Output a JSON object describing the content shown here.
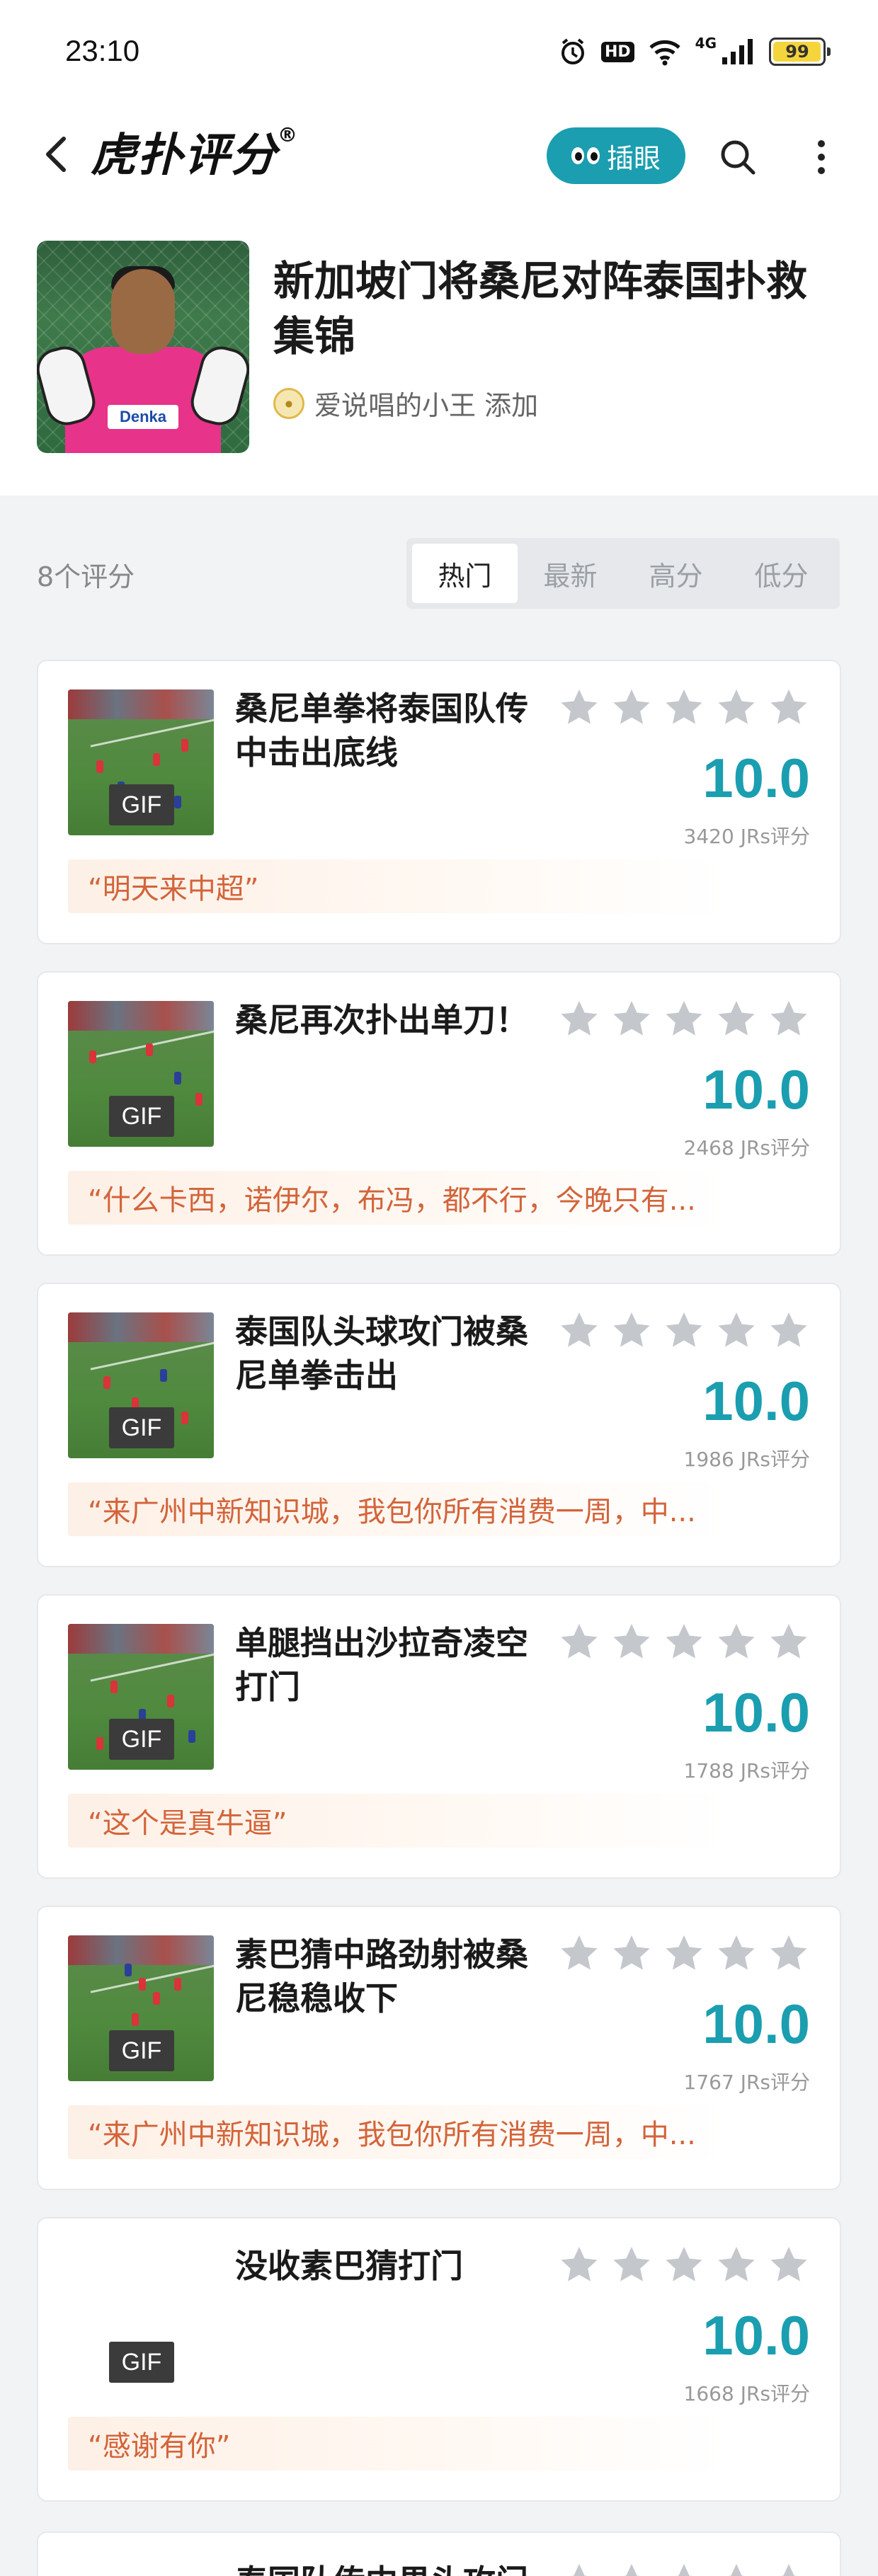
{
  "status_bar": {
    "time": "23:10",
    "hd": "HD",
    "network": "4G",
    "battery": "99",
    "battery_level": 0.99
  },
  "nav": {
    "logo": "虎扑评分",
    "logo_mark": "®",
    "insert_label": "插眼"
  },
  "header": {
    "title": "新加坡门将桑尼对阵泰国扑救集锦",
    "adder": "爱说唱的小王 添加"
  },
  "filter": {
    "count": "8个评分",
    "tabs": [
      "热门",
      "最新",
      "高分",
      "低分"
    ],
    "active_tab": 0
  },
  "items": [
    {
      "title": "桑尼单拳将泰国队传中击出底线",
      "score": "10.0",
      "votes": "3420 JRs评分",
      "comment": "“明天来中超”",
      "gif": "GIF"
    },
    {
      "title": "桑尼再次扑出单刀！",
      "score": "10.0",
      "votes": "2468 JRs评分",
      "comment": "“什么卡西，诺伊尔，布冯，都不行，今晚只有...",
      "gif": "GIF"
    },
    {
      "title": "泰国队头球攻门被桑尼单拳击出",
      "score": "10.0",
      "votes": "1986 JRs评分",
      "comment": "“来广州中新知识城，我包你所有消费一周，中...",
      "gif": "GIF"
    },
    {
      "title": "单腿挡出沙拉奇凌空打门",
      "score": "10.0",
      "votes": "1788 JRs评分",
      "comment": "“这个是真牛逼”",
      "gif": "GIF"
    },
    {
      "title": "素巴猜中路劲射被桑尼稳稳收下",
      "score": "10.0",
      "votes": "1767 JRs评分",
      "comment": "“来广州中新知识城，我包你所有消费一周，中...",
      "gif": "GIF"
    },
    {
      "title": "没收素巴猜打门",
      "score": "10.0",
      "votes": "1668 JRs评分",
      "comment": "“感谢有你”",
      "gif": "GIF"
    }
  ],
  "partial_item": {
    "title": "泰国队传中果头攻门"
  },
  "colors": {
    "accent": "#1a9eb0",
    "comment": "#d3643a",
    "star": "#c4c7cc"
  }
}
